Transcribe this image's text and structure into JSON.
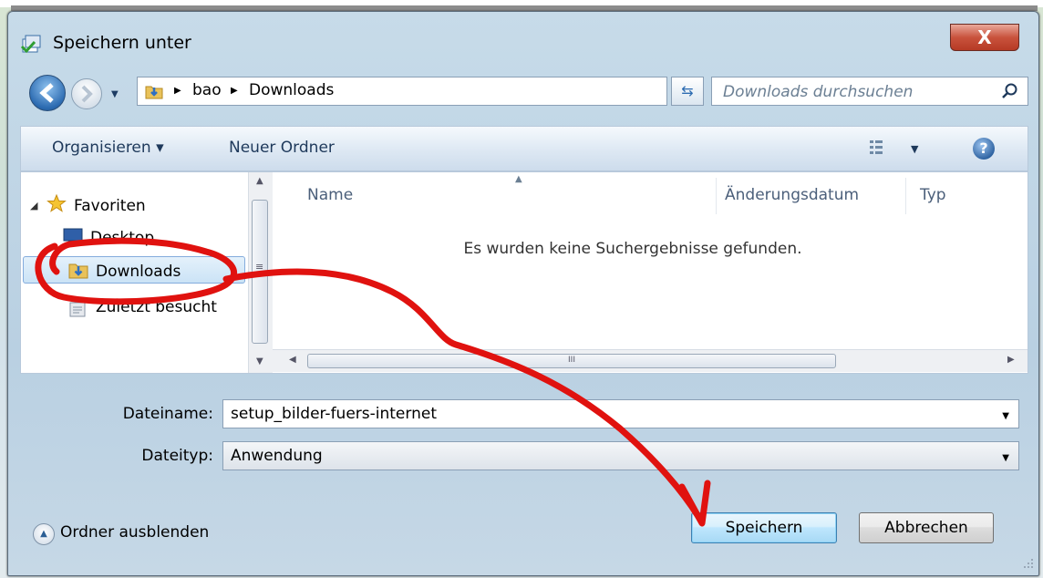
{
  "window": {
    "title": "Speichern unter",
    "close_label": "X"
  },
  "nav": {
    "breadcrumb": [
      "bao",
      "Downloads"
    ],
    "search_placeholder": "Downloads durchsuchen"
  },
  "toolbar": {
    "organize": "Organisieren ▾",
    "new_folder": "Neuer Ordner"
  },
  "sidebar": {
    "items": [
      {
        "label": "Favoriten",
        "icon": "star-icon"
      },
      {
        "label": "Desktop",
        "icon": "desktop-icon"
      },
      {
        "label": "Downloads",
        "icon": "downloads-folder-icon",
        "selected": true
      },
      {
        "label": "Zuletzt besucht",
        "icon": "recent-places-icon"
      }
    ]
  },
  "list": {
    "columns": [
      "Name",
      "Änderungsdatum",
      "Typ"
    ],
    "empty_message": "Es wurden keine Suchergebnisse gefunden.",
    "hscroll_grip": "III"
  },
  "form": {
    "filename_label": "Dateiname:",
    "filename_value": "setup_bilder-fuers-internet",
    "filetype_label": "Dateityp:",
    "filetype_value": "Anwendung"
  },
  "footer": {
    "hide_folders": "Ordner ausblenden",
    "save": "Speichern",
    "cancel": "Abbrechen"
  },
  "colors": {
    "annotation": "#e0120f",
    "accent": "#1e395b"
  }
}
